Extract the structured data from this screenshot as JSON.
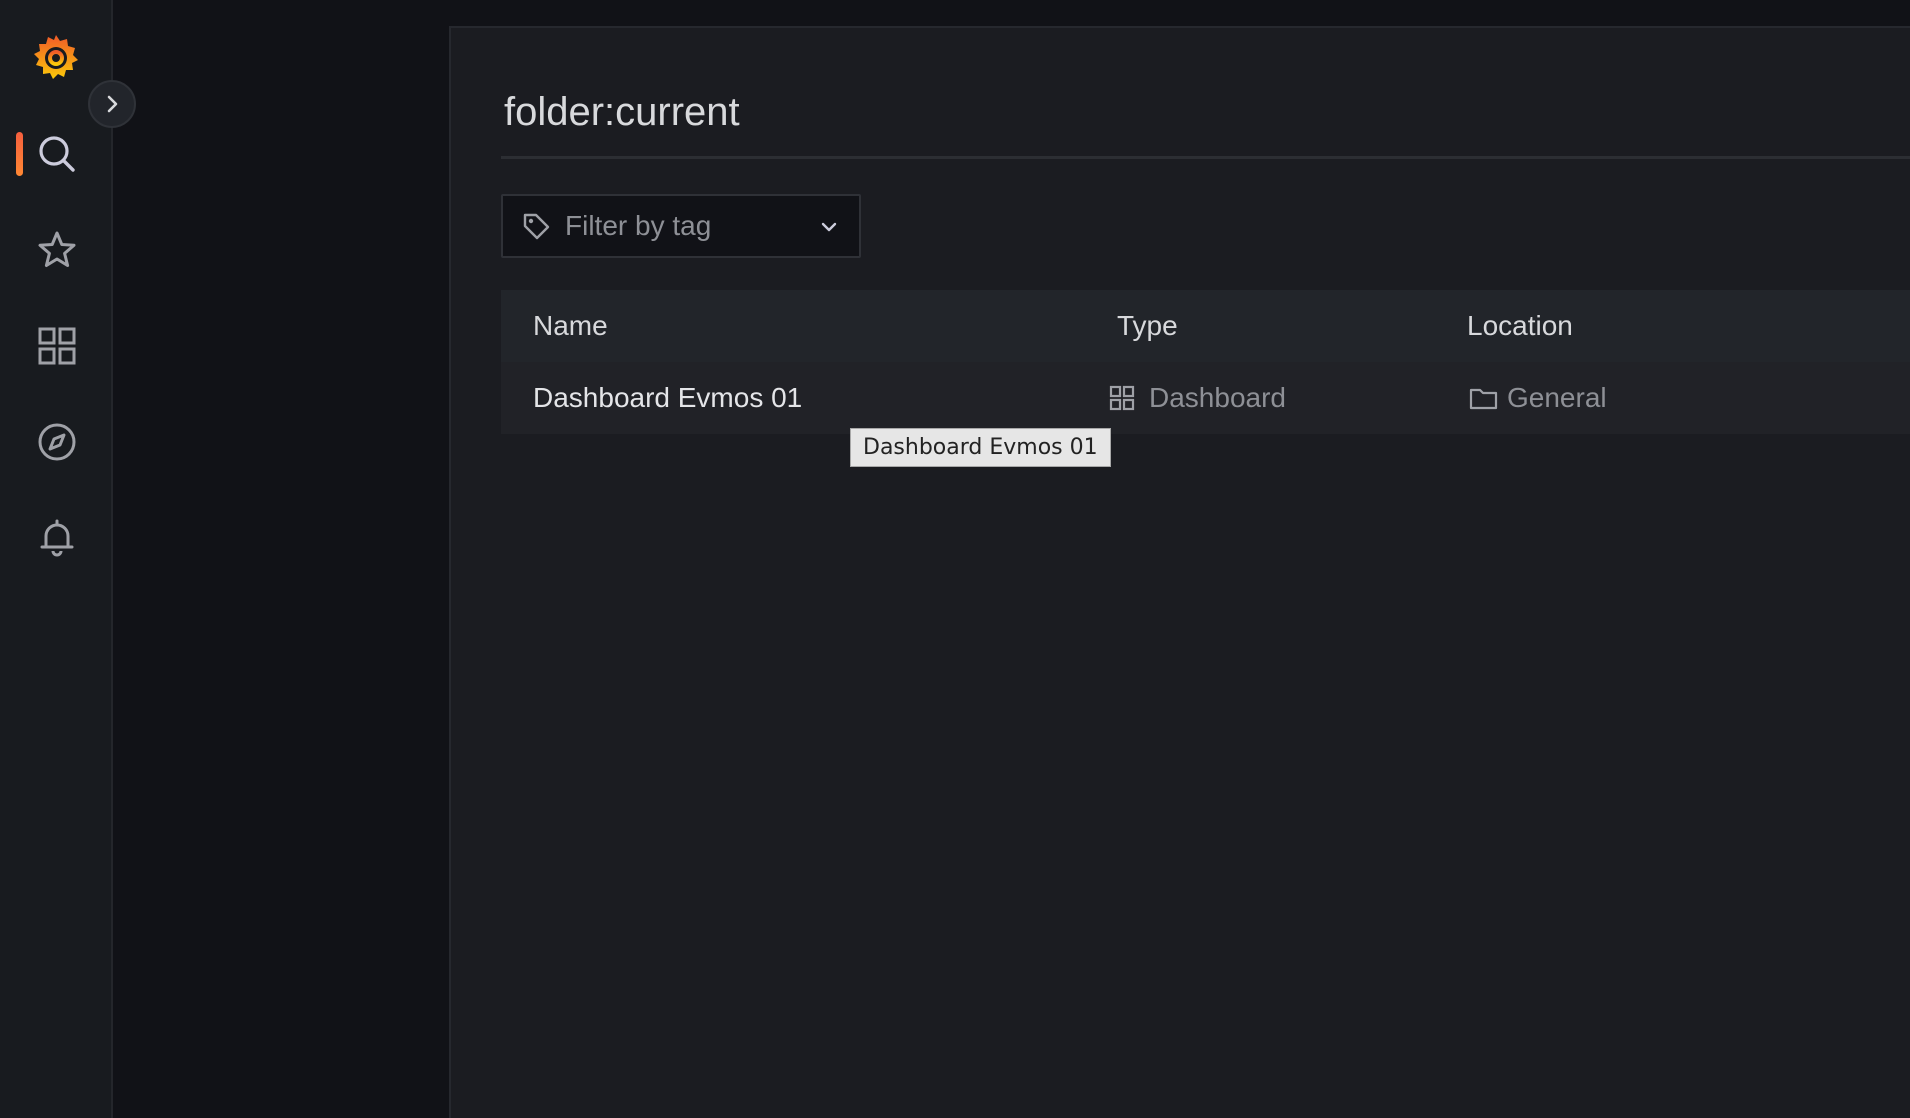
{
  "sidebar": {
    "logo_icon": "grafana-logo-icon",
    "items": [
      {
        "name": "search",
        "icon": "search-icon",
        "active": true
      },
      {
        "name": "starred",
        "icon": "star-icon",
        "active": false
      },
      {
        "name": "dashboards",
        "icon": "dashboards-grid-icon",
        "active": false
      },
      {
        "name": "explore",
        "icon": "compass-icon",
        "active": false
      },
      {
        "name": "alerting",
        "icon": "bell-icon",
        "active": false
      }
    ],
    "expand_icon": "chevron-right-icon"
  },
  "main": {
    "title": "folder:current",
    "tag_filter": {
      "placeholder": "Filter by tag",
      "icon": "tag-icon",
      "dropdown_icon": "chevron-down-icon"
    },
    "table": {
      "headers": {
        "name": "Name",
        "type": "Type",
        "location": "Location"
      },
      "rows": [
        {
          "name": "Dashboard Evmos 01",
          "type": "Dashboard",
          "type_icon": "dashboard-grid-icon",
          "location": "General",
          "location_icon": "folder-icon"
        }
      ]
    },
    "tooltip": "Dashboard Evmos 01"
  },
  "colors": {
    "accent": "#f55f3e",
    "background": "#111217",
    "panel": "#1b1c21"
  }
}
